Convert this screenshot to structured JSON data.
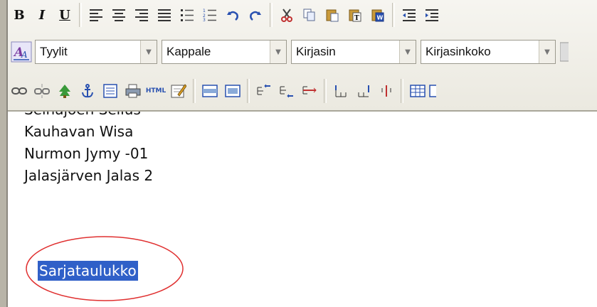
{
  "toolbar": {
    "row1": [
      {
        "name": "bold-button",
        "label": "B"
      },
      {
        "name": "italic-button",
        "label": "I"
      },
      {
        "name": "underline-button",
        "label": "U"
      }
    ],
    "styles_select": "Tyylit",
    "paragraph_select": "Kappale",
    "font_select": "Kirjasin",
    "fontsize_select": "Kirjasinkoko",
    "html_button": "HTML"
  },
  "editor": {
    "lines": [
      "Seinäjoen Sellus",
      "Kauhavan Wisa",
      "Nurmon Jymy -01",
      "Jalasjärven Jalas 2"
    ],
    "selected_text": "Sarjataulukko"
  },
  "colors": {
    "selection": "#3060c8",
    "annotation_oval": "#e03030"
  }
}
